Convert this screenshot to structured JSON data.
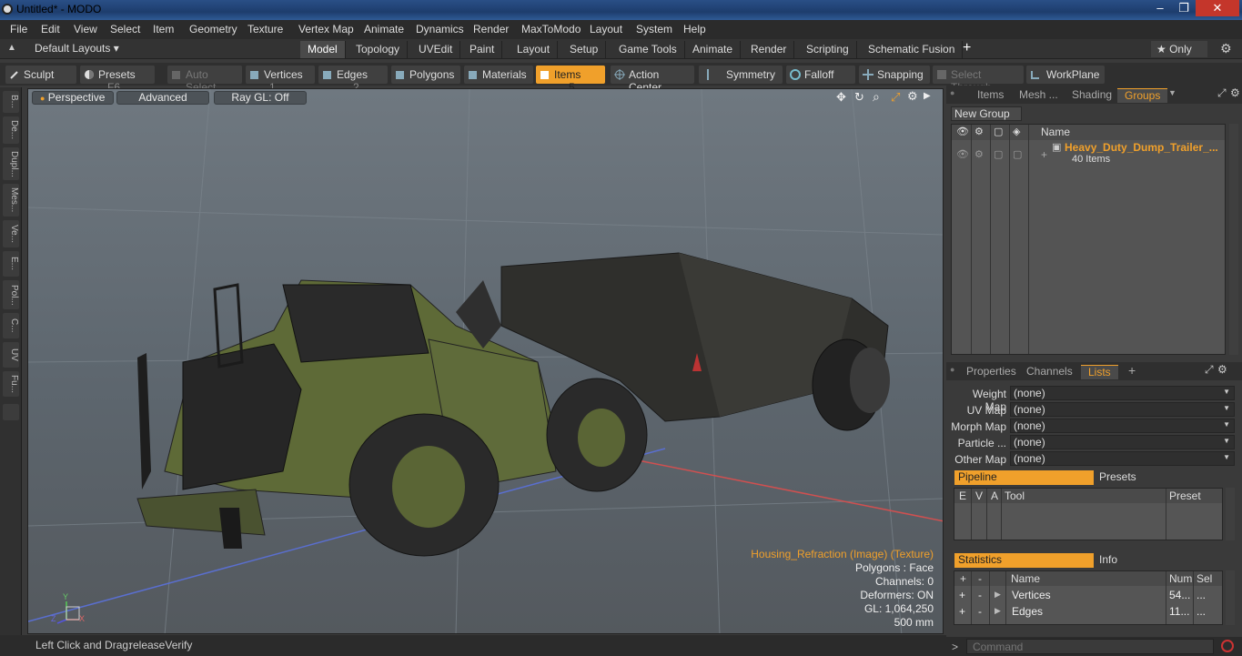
{
  "window": {
    "title": "Untitled* - MODO",
    "minimize": "–",
    "restore": "❐",
    "close": "✕"
  },
  "menu": [
    "File",
    "Edit",
    "View",
    "Select",
    "Item",
    "Geometry",
    "Texture",
    "Vertex Map",
    "Animate",
    "Dynamics",
    "Render",
    "MaxToModo",
    "Layout",
    "System",
    "Help"
  ],
  "layout": {
    "default_layouts": "Default Layouts ▾",
    "tabs": [
      "Model",
      "Topology",
      "UVEdit",
      "Paint",
      "Layout",
      "Setup",
      "Game Tools",
      "Animate",
      "Render",
      "Scripting",
      "Schematic Fusion"
    ],
    "active_tab": "Model",
    "add": "+",
    "only": "★ Only",
    "gear": "⚙"
  },
  "toolbar": {
    "sculpt": "Sculpt",
    "presets": "Presets",
    "presets_key": "F6",
    "auto_select": "Auto Select",
    "vertices": "Vertices",
    "vertices_key": "1",
    "edges": "Edges",
    "edges_key": "2",
    "polygons": "Polygons",
    "materials": "Materials",
    "items": "Items",
    "items_key": "5",
    "action_center": "Action Center",
    "symmetry": "Symmetry",
    "falloff": "Falloff",
    "snapping": "Snapping",
    "select_through": "Select Through",
    "workplane": "WorkPlane"
  },
  "left_tabs": [
    "B...",
    "De...",
    "Dupl...",
    "Mes...",
    "Ve...",
    "E...",
    "Pol...",
    "C...",
    "UV",
    "Fu..."
  ],
  "viewport": {
    "perspective": "Perspective",
    "advanced": "Advanced",
    "raygl": "Ray GL: Off",
    "axis": {
      "y": "Y",
      "x": "X",
      "z": "Z"
    },
    "hud": {
      "texture": "Housing_Refraction (Image) (Texture)",
      "polygons": "Polygons : Face",
      "channels": "Channels: 0",
      "deformers": "Deformers: ON",
      "gl": "GL: 1,064,250",
      "scale": "500 mm"
    }
  },
  "status": {
    "hint_label": "Left Click and Drag:",
    "hint_value": "releaseVerify"
  },
  "groups_panel": {
    "tabs": [
      "Items",
      "Mesh ...",
      "Shading",
      "Groups"
    ],
    "active": "Groups",
    "new_group": "New Group",
    "col_name": "Name",
    "group_name": "Heavy_Duty_Dump_Trailer_...",
    "group_count": "40 Items"
  },
  "lists_panel": {
    "tabs": [
      "Properties",
      "Channels",
      "Lists"
    ],
    "active": "Lists",
    "add": "+",
    "rows": [
      {
        "label": "Weight Map",
        "value": "(none)"
      },
      {
        "label": "UV Map",
        "value": "(none)"
      },
      {
        "label": "Morph Map",
        "value": "(none)"
      },
      {
        "label": "Particle ...",
        "value": "(none)"
      },
      {
        "label": "Other Map",
        "value": "(none)"
      }
    ],
    "pipeline": "Pipeline",
    "presets": "Presets",
    "pipe_cols": [
      "E",
      "V",
      "A",
      "Tool",
      "Preset"
    ],
    "statistics": "Statistics",
    "info": "Info",
    "stat_cols": [
      "+",
      "-",
      "Name",
      "Num",
      "Sel"
    ],
    "stat_rows": [
      {
        "plus": "+",
        "minus": "-",
        "name": "Vertices",
        "num": "54...",
        "sel": "..."
      },
      {
        "plus": "+",
        "minus": "-",
        "name": "Edges",
        "num": "11...",
        "sel": "..."
      }
    ],
    "command_placeholder": "Command"
  }
}
